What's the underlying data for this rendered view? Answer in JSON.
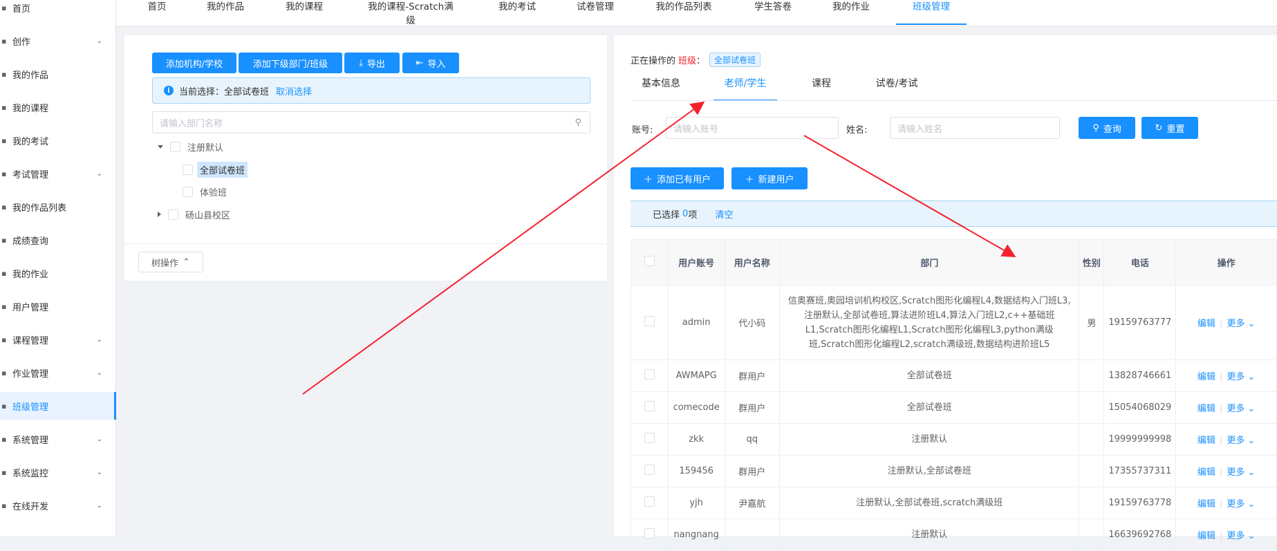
{
  "sidebar": {
    "items": [
      {
        "label": "首页",
        "chev": false,
        "active": false
      },
      {
        "label": "创作",
        "chev": true,
        "active": false
      },
      {
        "label": "我的作品",
        "chev": false,
        "active": false
      },
      {
        "label": "我的课程",
        "chev": false,
        "active": false
      },
      {
        "label": "我的考试",
        "chev": false,
        "active": false
      },
      {
        "label": "考试管理",
        "chev": true,
        "active": false
      },
      {
        "label": "我的作品列表",
        "chev": false,
        "active": false
      },
      {
        "label": "成绩查询",
        "chev": false,
        "active": false
      },
      {
        "label": "我的作业",
        "chev": false,
        "active": false
      },
      {
        "label": "用户管理",
        "chev": false,
        "active": false
      },
      {
        "label": "课程管理",
        "chev": true,
        "active": false
      },
      {
        "label": "作业管理",
        "chev": true,
        "active": false
      },
      {
        "label": "班级管理",
        "chev": false,
        "active": true
      },
      {
        "label": "系统管理",
        "chev": true,
        "active": false
      },
      {
        "label": "系统监控",
        "chev": true,
        "active": false
      },
      {
        "label": "在线开发",
        "chev": true,
        "active": false
      }
    ]
  },
  "topnav": {
    "tabs": [
      "首页",
      "我的作品",
      "我的课程",
      "我的课程-Scratch满级",
      "我的考试",
      "试卷管理",
      "我的作品列表",
      "学生答卷",
      "我的作业",
      "班级管理"
    ],
    "active_index": 9
  },
  "left": {
    "buttons": {
      "add_org": "添加机构/学校",
      "add_sub": "添加下级部门/班级",
      "export": "导出",
      "import": "导入"
    },
    "info": {
      "prefix": "当前选择：",
      "selected": "全部试卷班",
      "cancel": "取消选择"
    },
    "search_placeholder": "请输入部门名称",
    "tree": {
      "root1": "注册默认",
      "child1": "全部试卷班",
      "child2": "体验班",
      "root2": "砀山县校区"
    },
    "tree_op": "树操作"
  },
  "right": {
    "operating_prefix": "正在操作的",
    "operating_class_label": "班级",
    "operating_suffix": "：",
    "class_tag": "全部试卷班",
    "tabs": [
      "基本信息",
      "老师/学生",
      "课程",
      "试卷/考试"
    ],
    "active_tab": 1,
    "account_label": "账号:",
    "account_placeholder": "请输入账号",
    "name_label": "姓名:",
    "name_placeholder": "请输入姓名",
    "query_btn": "查询",
    "reset_btn": "重置",
    "add_existing": "添加已有用户",
    "new_user": "新建用户",
    "selected_prefix": "已选择",
    "selected_count": "0",
    "selected_suffix": "项",
    "clear": "清空"
  },
  "table": {
    "headers": [
      "用户账号",
      "用户名称",
      "部门",
      "性别",
      "电话",
      "操作"
    ],
    "edit": "编辑",
    "more": "更多",
    "rows": [
      {
        "account": "admin",
        "name": "代小码",
        "dept": "信奥赛班,奥园培训机构校区,Scratch图形化编程L4,数据结构入门班L3,注册默认,全部试卷班,算法进阶班L4,算法入门班L2,c++基础班L1,Scratch图形化编程L1,Scratch图形化编程L3,python满级班,Scratch图形化编程L2,scratch满级班,数据结构进阶班L5",
        "gender": "男",
        "phone": "19159763777"
      },
      {
        "account": "AWMAPG",
        "name": "群用户",
        "dept": "全部试卷班",
        "gender": "",
        "phone": "13828746661"
      },
      {
        "account": "comecode",
        "name": "群用户",
        "dept": "全部试卷班",
        "gender": "",
        "phone": "15054068029"
      },
      {
        "account": "zkk",
        "name": "qq",
        "dept": "注册默认",
        "gender": "",
        "phone": "19999999998"
      },
      {
        "account": "159456",
        "name": "群用户",
        "dept": "注册默认,全部试卷班",
        "gender": "",
        "phone": "17355737311"
      },
      {
        "account": "yjh",
        "name": "尹嘉航",
        "dept": "注册默认,全部试卷班,scratch满级班",
        "gender": "",
        "phone": "19159763778"
      },
      {
        "account": "nangnang",
        "name": "",
        "dept": "注册默认",
        "gender": "",
        "phone": "16639692768"
      }
    ]
  },
  "colors": {
    "accent": "#1890ff",
    "annotation_arrow": "#f5222d"
  }
}
